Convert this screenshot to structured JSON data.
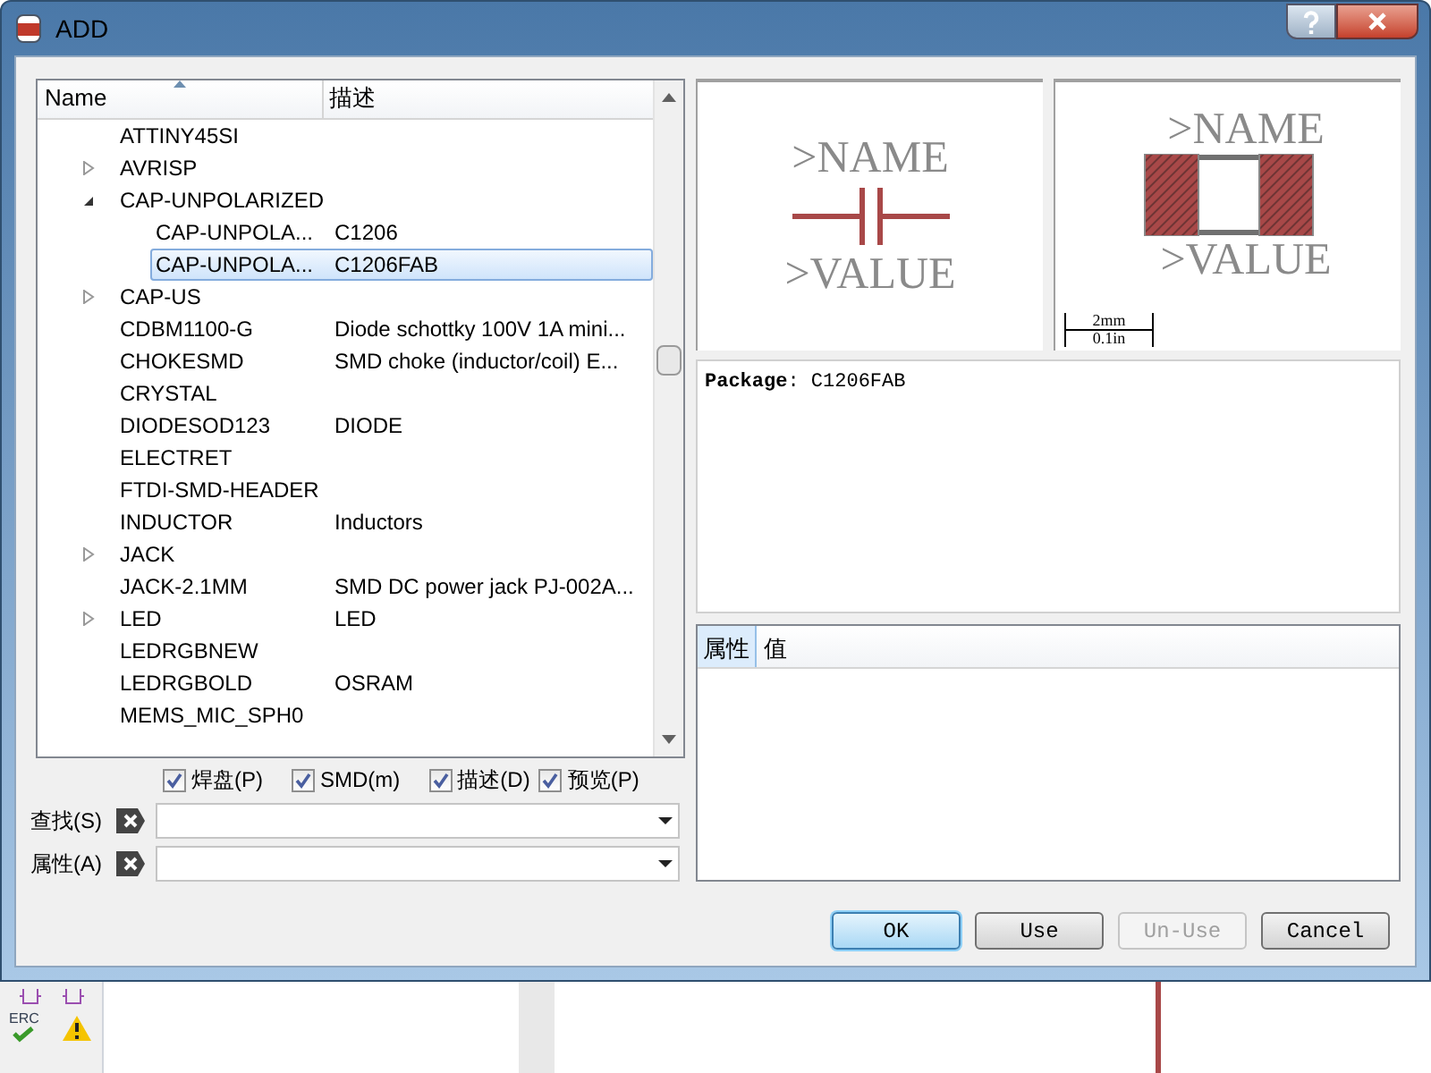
{
  "window": {
    "title": "ADD"
  },
  "tree": {
    "columns": [
      "Name",
      "描述"
    ],
    "items": [
      {
        "kind": "device",
        "name": "ATTINY45SI"
      },
      {
        "kind": "folder",
        "name": "AVRISP",
        "expanded": false
      },
      {
        "kind": "folder",
        "name": "CAP-UNPOLARIZED",
        "expanded": true,
        "children": [
          {
            "name": "CAP-UNPOLA...",
            "description": "C1206",
            "selected": false
          },
          {
            "name": "CAP-UNPOLA...",
            "description": "C1206FAB",
            "selected": true
          }
        ]
      },
      {
        "kind": "folder",
        "name": "CAP-US",
        "expanded": false
      },
      {
        "kind": "device",
        "name": "CDBM1100-G",
        "description": "Diode schottky 100V 1A mini..."
      },
      {
        "kind": "device",
        "name": "CHOKESMD",
        "description": "SMD choke (inductor/coil) E..."
      },
      {
        "kind": "device",
        "name": "CRYSTAL"
      },
      {
        "kind": "device",
        "name": "DIODESOD123",
        "description": "DIODE"
      },
      {
        "kind": "device",
        "name": "ELECTRET"
      },
      {
        "kind": "device",
        "name": "FTDI-SMD-HEADER"
      },
      {
        "kind": "device",
        "name": "INDUCTOR",
        "description": "Inductors"
      },
      {
        "kind": "folder",
        "name": "JACK",
        "expanded": false
      },
      {
        "kind": "device",
        "name": "JACK-2.1MM",
        "description": "SMD DC power jack PJ-002A..."
      },
      {
        "kind": "folder",
        "name": "LED",
        "description": "LED",
        "expanded": false
      },
      {
        "kind": "device",
        "name": "LEDRGBNEW"
      },
      {
        "kind": "device",
        "name": "LEDRGBOLD",
        "description": "OSRAM"
      },
      {
        "kind": "device",
        "name": "MEMS_MIC_SPH0"
      }
    ]
  },
  "filters": [
    {
      "label": "焊盘(P)",
      "checked": true
    },
    {
      "label": "SMD(m)",
      "checked": true
    },
    {
      "label": "描述(D)",
      "checked": true
    },
    {
      "label": "预览(P)",
      "checked": true
    }
  ],
  "fields": [
    {
      "label": "查找(S)"
    },
    {
      "label": "属性(A)"
    }
  ],
  "symbol_preview": {
    "name_text": ">NAME",
    "value_text": ">VALUE"
  },
  "package_preview": {
    "name_text": ">NAME",
    "value_text": ">VALUE",
    "scale_top": "2mm",
    "scale_bottom": "0.1in"
  },
  "info": "**Package**: C1206FAB",
  "attributes": {
    "columns": [
      "属性",
      "值"
    ]
  },
  "buttons": [
    {
      "label": "OK",
      "default": true,
      "disabled": false
    },
    {
      "label": "Use",
      "default": false,
      "disabled": false
    },
    {
      "label": "Un-Use",
      "default": false,
      "disabled": true
    },
    {
      "label": "Cancel",
      "default": false,
      "disabled": false
    }
  ],
  "background": {
    "erc_label": "ERC"
  }
}
